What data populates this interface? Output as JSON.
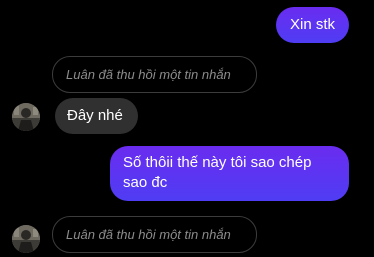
{
  "thread": {
    "messages": [
      {
        "sender": "me",
        "kind": "text",
        "text": "Xin stk"
      },
      {
        "sender": "Luân",
        "kind": "unsent",
        "text": "Luân đã thu hồi một tin nhắn"
      },
      {
        "sender": "Luân",
        "kind": "text",
        "text": "Đây nhé"
      },
      {
        "sender": "me",
        "kind": "text",
        "text": "Số thôii thế này tôi sao chép sao đc"
      },
      {
        "sender": "Luân",
        "kind": "unsent",
        "text": "Luân đã thu hồi một tin nhắn"
      }
    ]
  },
  "colors": {
    "background": "#000000",
    "outgoing_bubble": "#5b34f2",
    "incoming_bubble": "#303030",
    "unsent_border": "#3c3c3c",
    "unsent_text": "#8c8c8c"
  }
}
